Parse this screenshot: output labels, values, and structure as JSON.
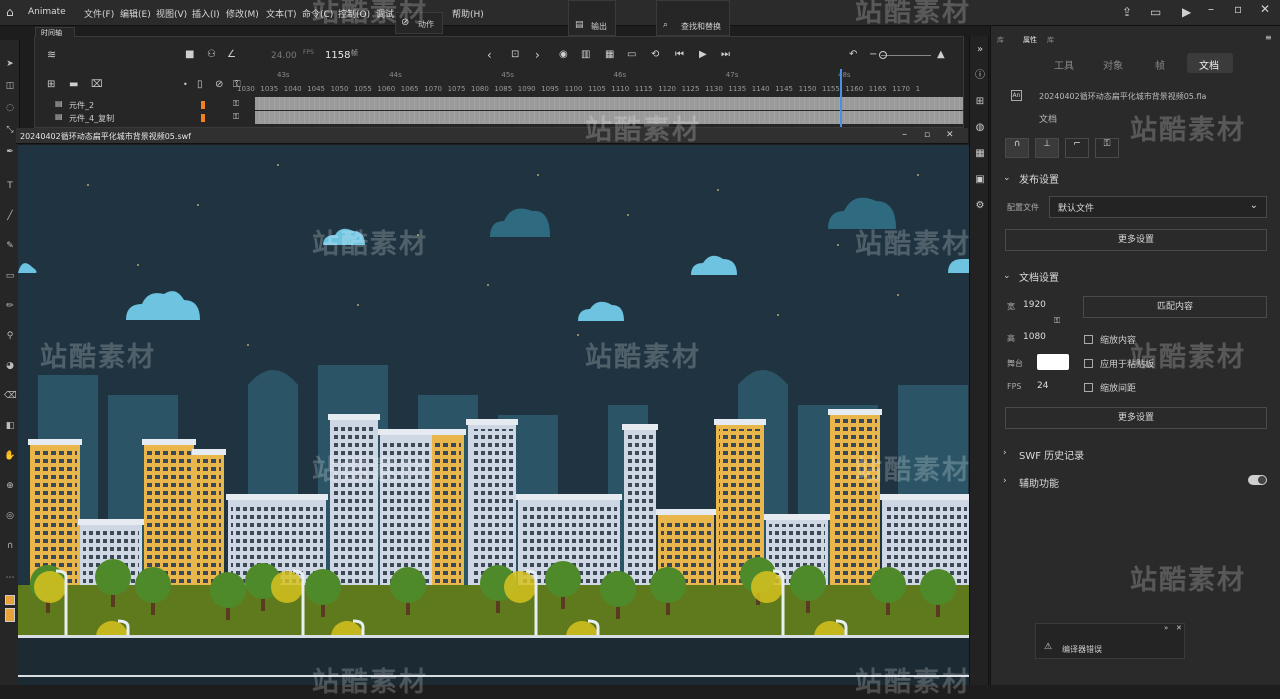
{
  "app": {
    "name": "Animate"
  },
  "menu": [
    "文件(F)",
    "编辑(E)",
    "视图(V)",
    "插入(I)",
    "修改(M)",
    "文本(T)",
    "命令(C)",
    "控制(O)",
    "调试",
    "帮助(H)"
  ],
  "floating_panels": {
    "actions": "动作",
    "output": "输出",
    "find_replace": "查找和替换",
    "compiler_errors": "编译器错误"
  },
  "timeline": {
    "tab": "时间轴",
    "fps": "24.00",
    "fps_unit": "FPS",
    "frame": "1158",
    "frame_unit": "帧",
    "seconds_marks": [
      "43s",
      "44s",
      "45s",
      "46s",
      "47s",
      "48s"
    ],
    "frame_marks": [
      "1030",
      "1035",
      "1040",
      "1045",
      "1050",
      "1055",
      "1060",
      "1065",
      "1070",
      "1075",
      "1080",
      "1085",
      "1090",
      "1095",
      "1100",
      "1105",
      "1110",
      "1115",
      "1120",
      "1125",
      "1130",
      "1135",
      "1140",
      "1145",
      "1150",
      "1155",
      "1160",
      "1165",
      "1170",
      "1"
    ],
    "playhead_frame": 1158,
    "layers": [
      {
        "name": "元件_2"
      },
      {
        "name": "元件_4_复制"
      }
    ]
  },
  "swf_window": {
    "title": "20240402循环动态扁平化城市背景视频05.swf"
  },
  "properties": {
    "tabs": [
      "库",
      "属性",
      "库"
    ],
    "active_tab": "属性",
    "subtabs": [
      "工具",
      "对象",
      "帧",
      "文档"
    ],
    "active_subtab": "文档",
    "file_icon": "An",
    "doc_name": "20240402循环动态扁平化城市背景视频05.fla",
    "doc_label": "文档",
    "publish": {
      "title": "发布设置",
      "profile_label": "配置文件",
      "profile_value": "默认文件",
      "more": "更多设置"
    },
    "doc_settings": {
      "title": "文档设置",
      "width_label": "宽",
      "width": "1920",
      "height_label": "高",
      "height": "1080",
      "stage_label": "舞台",
      "stage_color": "#ffffff",
      "fps_label": "FPS",
      "fps": "24",
      "match": "匹配内容",
      "scale_content": "缩放内容",
      "apply_pasteboard": "应用于粘贴板",
      "scale_spacing": "缩放间距",
      "more": "更多设置"
    },
    "swf_history": "SWF 历史记录",
    "accessibility": "辅助功能"
  },
  "watermark": "站酷素材",
  "colors": {
    "accent": "#4a8fe7",
    "sky": "#1f3440",
    "grass": "#5f7a1c",
    "road": "#1c2a33",
    "lamp": "#d6c21f",
    "moon": "#f0c040",
    "cloud": "#6ec3e0"
  }
}
